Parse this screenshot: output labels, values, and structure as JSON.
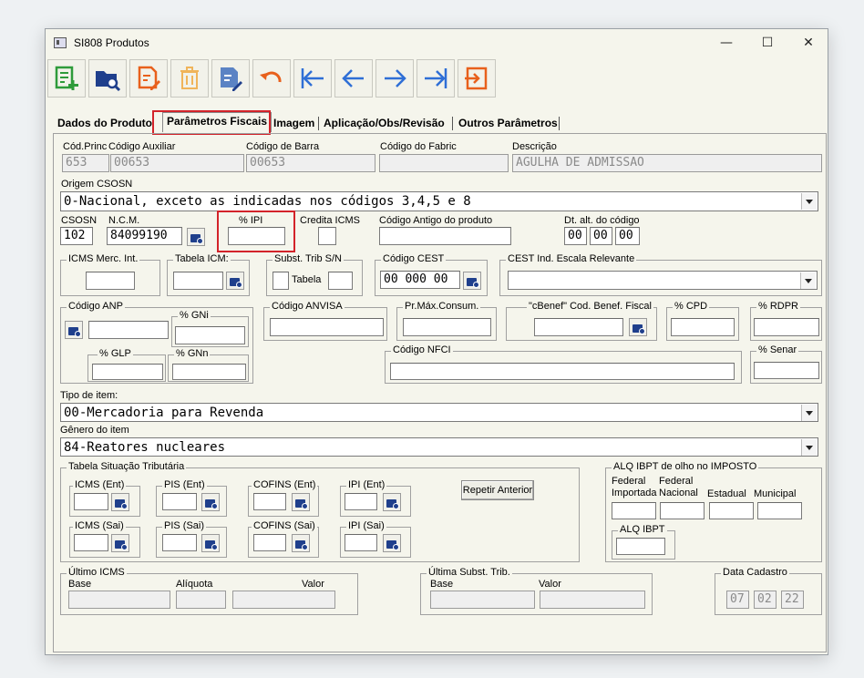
{
  "window": {
    "title": "SI808 Produtos",
    "minimize": "—",
    "maximize": "☐",
    "close": "✕"
  },
  "toolbar": [
    "new-doc-icon",
    "search-folder-icon",
    "edit-doc-icon",
    "trash-icon",
    "edit-sign-icon",
    "undo-icon",
    "first-icon",
    "prev-icon",
    "next-icon",
    "last-icon",
    "exit-icon"
  ],
  "tabs": {
    "t1": "Dados do  Produto",
    "t2": "Parâmetros Fiscais",
    "t3": "Imagem",
    "t4": "Aplicação/Obs/Revisão",
    "t5": "Outros Parâmetros"
  },
  "labels": {
    "cod_princ": "Cód.Princ",
    "cod_aux": "Código Auxiliar",
    "cod_barra": "Código de Barra",
    "cod_fabric": "Código do Fabric",
    "descricao": "Descrição",
    "origem": "Origem CSOSN",
    "csosn": "CSOSN",
    "ncm": "N.C.M.",
    "pipi": "% IPI",
    "credita": "Credita ICMS",
    "cod_antigo": "Código Antigo do produto",
    "dt_alt": "Dt. alt. do código",
    "icms_merc": "ICMS Merc. Int.",
    "tabela_icm": "Tabela ICM:",
    "subst": "Subst. Trib S/N",
    "tabela": "Tabela",
    "cest": "Código CEST",
    "cest_ind": "CEST Ind. Escala Relevante",
    "anp": "Código ANP",
    "gni": "% GNi",
    "glp": "% GLP",
    "gnn": "% GNn",
    "anvisa": "Código ANVISA",
    "prmax": "Pr.Máx.Consum.",
    "cbenef": "\"cBenef\" Cod. Benef. Fiscal",
    "cpd": "% CPD",
    "rdpr": "% RDPR",
    "nfci": "Código NFCI",
    "senar": "% Senar",
    "tipo_item": "Tipo de item:",
    "genero": "Gênero do item",
    "tab_sit": "Tabela Situação Tributária",
    "icms_ent": "ICMS (Ent)",
    "pis_ent": "PIS (Ent)",
    "cofins_ent": "COFINS (Ent)",
    "ipi_ent": "IPI (Ent)",
    "icms_sai": "ICMS (Sai)",
    "pis_sai": "PIS (Sai)",
    "cofins_sai": "COFINS (Sai)",
    "ipi_sai": "IPI (Sai)",
    "repetir": "Repetir Anterior",
    "alq_ibpt_title": "ALQ IBPT de olho no IMPOSTO",
    "fed_imp": "Federal\nImportada",
    "fed_nac": "Federal\nNacional",
    "estadual": "Estadual",
    "municipal": "Municipal",
    "alq_ibpt": "ALQ IBPT",
    "ult_icms": "Último ICMS",
    "base": "Base",
    "aliquota": "Alíquota",
    "valor": "Valor",
    "ult_subst": "Última Subst. Trib.",
    "base2": "Base",
    "valor2": "Valor",
    "data_cad": "Data Cadastro"
  },
  "values": {
    "cod_princ": "653",
    "cod_aux": "00653",
    "cod_barra": "00653",
    "descricao": "AGULHA DE ADMISSAO",
    "origem": "0-Nacional, exceto as indicadas nos códigos 3,4,5 e 8",
    "csosn": "102",
    "ncm": "84099190",
    "dt1": "00",
    "dt2": "00",
    "dt3": "00",
    "cest": "00 000 00",
    "tipo_item": "00-Mercadoria para Revenda",
    "genero": "84-Reatores nucleares",
    "dc1": "07",
    "dc2": "02",
    "dc3": "22"
  }
}
